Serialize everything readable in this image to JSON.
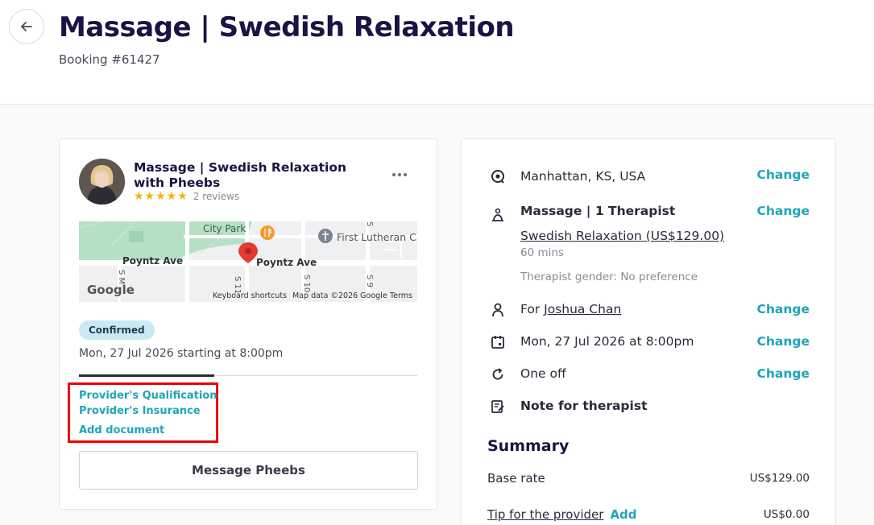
{
  "header": {
    "title": "Massage | Swedish Relaxation",
    "subtitle": "Booking #61427"
  },
  "provider": {
    "title": "Massage | Swedish Relaxation with Pheebs",
    "stars": "★★★★★",
    "rating": 5,
    "reviews": "2 reviews"
  },
  "map": {
    "labels": {
      "park": "City Park",
      "church": "First Lutheran C",
      "street_left": "Poyntz Ave",
      "street_right": "Poyntz Ave",
      "s11": "S 11",
      "s10": "S 10",
      "s9": "S 9",
      "s_left": "S M",
      "s_top": "S",
      "logo": "Google",
      "shortcuts": "Keyboard shortcuts",
      "mapdata": "Map data ©2026 Google",
      "terms": "Terms"
    }
  },
  "booking": {
    "status": "Confirmed",
    "time": "Mon, 27 Jul 2026 starting at 8:00pm"
  },
  "documents": {
    "qualification": "Provider's Qualification",
    "insurance": "Provider's Insurance",
    "add": "Add document"
  },
  "message_button": "Message Pheebs",
  "details": {
    "location": "Manhattan, KS, USA",
    "service": "Massage | 1 Therapist",
    "treatment": "Swedish Relaxation (US$129.00)",
    "duration": "60 mins",
    "gender": "Therapist gender: No preference",
    "for_prefix": "For",
    "for_name": "Joshua Chan",
    "datetime": "Mon, 27 Jul 2026 at 8:00pm",
    "frequency": "One off",
    "note": "Note for therapist",
    "change_label": "Change"
  },
  "summary": {
    "title": "Summary",
    "base_rate_label": "Base rate",
    "base_rate_value": "US$129.00",
    "tip_label": "Tip for the provider",
    "tip_add": "Add",
    "tip_value": "US$0.00"
  },
  "colors": {
    "accent": "#1fa5b7",
    "title": "#1c1243",
    "badge_bg": "#c9eaf2",
    "highlight": "#f00000",
    "star": "#f5b400"
  }
}
